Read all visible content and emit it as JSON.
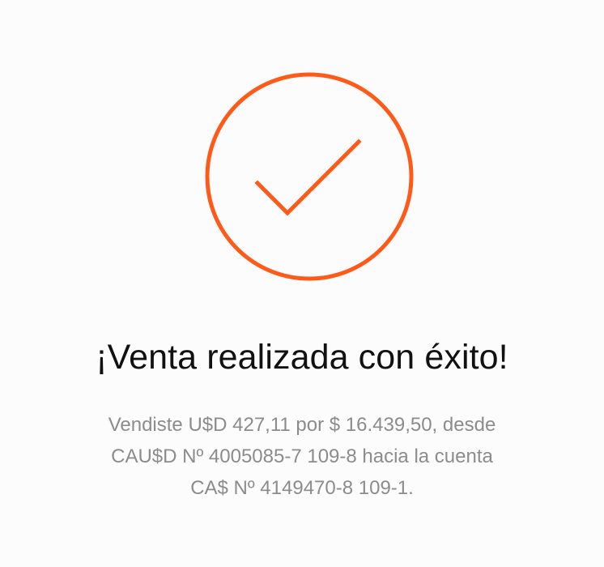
{
  "accent_color": "#ff5a18",
  "success": {
    "icon": "checkmark-circle-icon",
    "title": "¡Venta realizada con éxito!",
    "message_lines": [
      "Vendiste U$D 427,11 por $ 16.439,50, desde",
      "CAU$D Nº 4005085-7 109-8 hacia la cuenta",
      "CA$ Nº 4149470-8 109-1."
    ]
  }
}
